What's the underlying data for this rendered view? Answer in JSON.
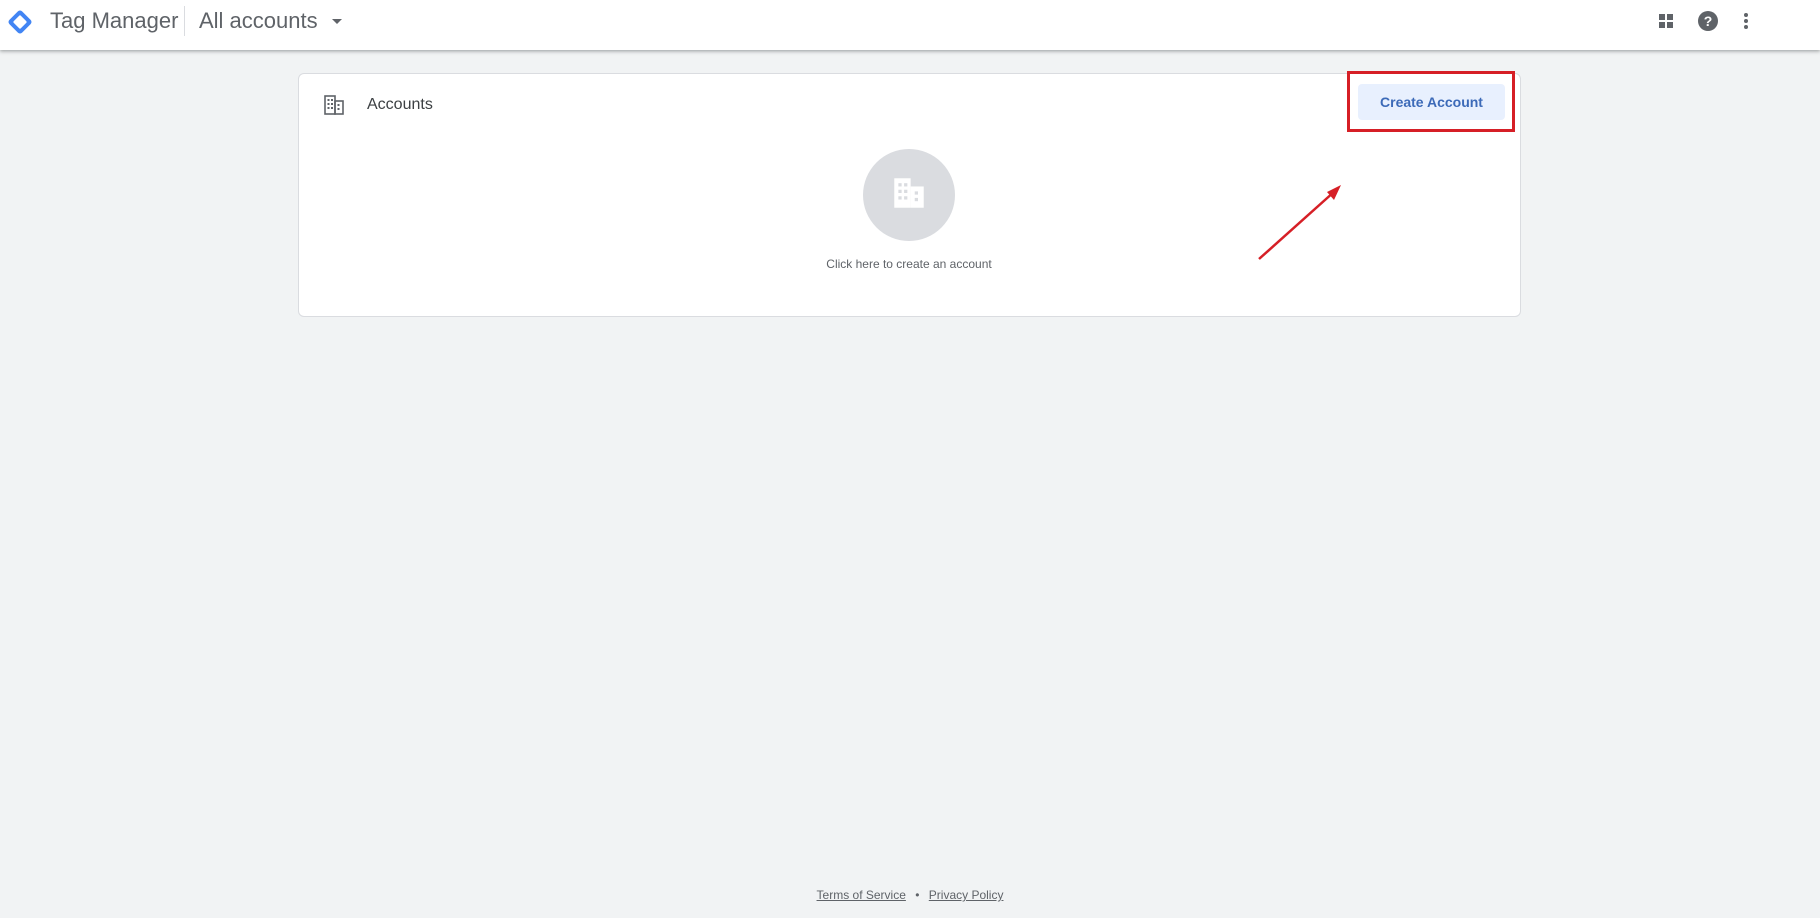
{
  "app": {
    "product_name": "Tag Manager",
    "account_switcher_label": "All accounts"
  },
  "header_icons": [
    {
      "name": "apps-grid-icon"
    },
    {
      "name": "help-icon"
    },
    {
      "name": "more-vert-icon"
    }
  ],
  "accounts_card": {
    "title": "Accounts",
    "create_button_label": "Create Account",
    "empty_state_text": "Click here to create an account"
  },
  "annotation": {
    "highlight_color": "#d61f26"
  },
  "footer": {
    "terms_label": "Terms of Service",
    "separator": "•",
    "privacy_label": "Privacy Policy"
  },
  "colors": {
    "background": "#f1f3f4",
    "button_bg": "#e8f0fe",
    "button_text": "#3c6ab8",
    "logo_blue": "#4285f4"
  }
}
